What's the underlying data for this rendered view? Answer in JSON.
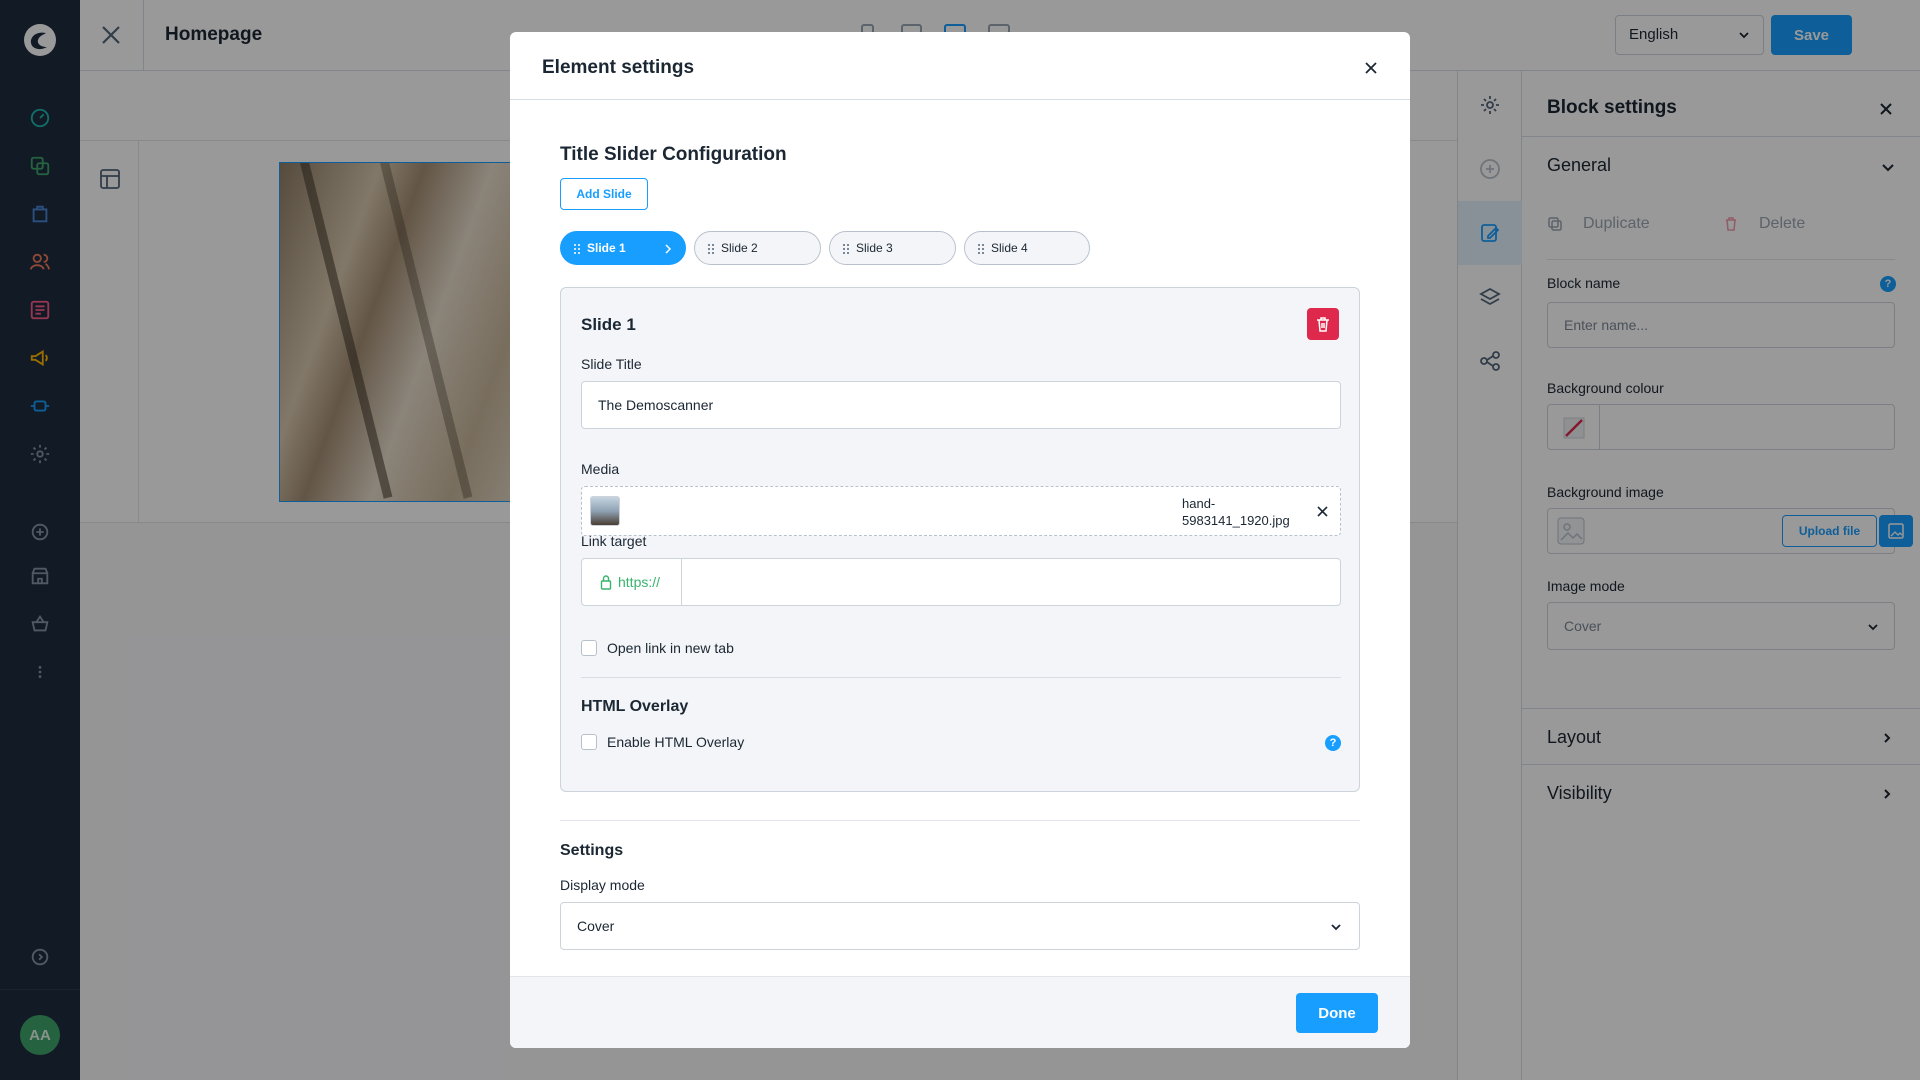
{
  "topbar": {
    "title": "Homepage",
    "language": "English",
    "save_label": "Save"
  },
  "avatar": {
    "initials": "AA"
  },
  "block_settings": {
    "title": "Block settings",
    "general": "General",
    "duplicate": "Duplicate",
    "delete": "Delete",
    "block_name_label": "Block name",
    "block_name_placeholder": "Enter name...",
    "bg_colour_label": "Background colour",
    "bg_image_label": "Background image",
    "upload_label": "Upload file",
    "image_mode_label": "Image mode",
    "image_mode_value": "Cover",
    "layout": "Layout",
    "visibility": "Visibility"
  },
  "modal": {
    "title": "Element settings",
    "config_title": "Title Slider Configuration",
    "add_slide": "Add Slide",
    "tabs": [
      "Slide 1",
      "Slide 2",
      "Slide 3",
      "Slide 4"
    ],
    "slide": {
      "title": "Slide 1",
      "slide_title_label": "Slide Title",
      "slide_title_value": "The Demoscanner",
      "media_label": "Media",
      "media_file": "hand-5983141_1920.jpg",
      "link_label": "Link target",
      "link_prefix": "https://",
      "open_new_tab": "Open link in new tab",
      "overlay_heading": "HTML Overlay",
      "enable_overlay": "Enable HTML Overlay"
    },
    "settings_heading": "Settings",
    "display_mode_label": "Display mode",
    "display_mode_value": "Cover",
    "done_label": "Done"
  },
  "colors": {
    "accent": "#189eff",
    "nav_bg": "#1f2d3f",
    "danger": "#de294c",
    "success": "#37b36d"
  }
}
